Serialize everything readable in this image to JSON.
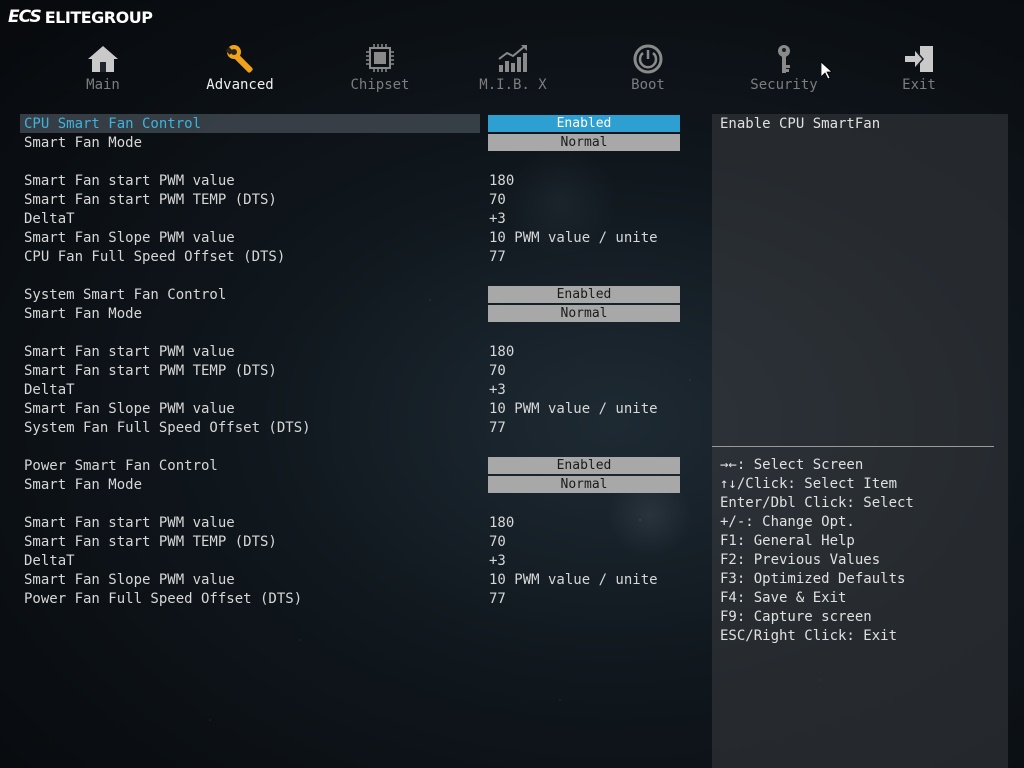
{
  "brand": {
    "logo": "ECS",
    "name": "ELITEGROUP"
  },
  "tabs": [
    {
      "label": "Main",
      "icon": "house-icon",
      "active": false
    },
    {
      "label": "Advanced",
      "icon": "wrench-icon",
      "active": true
    },
    {
      "label": "Chipset",
      "icon": "chip-icon",
      "active": false
    },
    {
      "label": "M.I.B. X",
      "icon": "chart-icon",
      "active": false
    },
    {
      "label": "Boot",
      "icon": "power-icon",
      "active": false
    },
    {
      "label": "Security",
      "icon": "key-icon",
      "active": false
    },
    {
      "label": "Exit",
      "icon": "exit-icon",
      "active": false
    }
  ],
  "settings": {
    "cpu_fan_control": {
      "label": "CPU Smart Fan Control",
      "value": "Enabled"
    },
    "cpu_fan_mode": {
      "label": "Smart Fan Mode",
      "value": "Normal"
    },
    "cpu_start_pwm": {
      "label": "Smart Fan start PWM value",
      "value": "180"
    },
    "cpu_start_temp": {
      "label": "Smart Fan start PWM TEMP (DTS)",
      "value": "70"
    },
    "cpu_delta": {
      "label": "DeltaT",
      "value": "+3"
    },
    "cpu_slope": {
      "label": "Smart Fan Slope PWM value",
      "value": "10 PWM value / unite"
    },
    "cpu_offset": {
      "label": "CPU Fan Full Speed Offset (DTS)",
      "value": "77"
    },
    "sys_fan_control": {
      "label": "System Smart Fan Control",
      "value": "Enabled"
    },
    "sys_fan_mode": {
      "label": "Smart Fan Mode",
      "value": "Normal"
    },
    "sys_start_pwm": {
      "label": "Smart Fan start PWM value",
      "value": "180"
    },
    "sys_start_temp": {
      "label": "Smart Fan start PWM TEMP (DTS)",
      "value": "70"
    },
    "sys_delta": {
      "label": "DeltaT",
      "value": "+3"
    },
    "sys_slope": {
      "label": "Smart Fan Slope PWM value",
      "value": "10 PWM value / unite"
    },
    "sys_offset": {
      "label": "System Fan Full Speed Offset (DTS)",
      "value": "77"
    },
    "pwr_fan_control": {
      "label": "Power Smart Fan Control",
      "value": "Enabled"
    },
    "pwr_fan_mode": {
      "label": "Smart Fan Mode",
      "value": "Normal"
    },
    "pwr_start_pwm": {
      "label": "Smart Fan start PWM value",
      "value": "180"
    },
    "pwr_start_temp": {
      "label": "Smart Fan start PWM TEMP (DTS)",
      "value": "70"
    },
    "pwr_delta": {
      "label": "DeltaT",
      "value": "+3"
    },
    "pwr_slope": {
      "label": "Smart Fan Slope PWM value",
      "value": "10 PWM value / unite"
    },
    "pwr_offset": {
      "label": "Power Fan Full Speed Offset (DTS)",
      "value": "77"
    }
  },
  "help": {
    "description": "Enable CPU SmartFan",
    "keys": [
      "→←: Select Screen",
      "↑↓/Click: Select Item",
      "Enter/Dbl Click: Select",
      "+/-: Change Opt.",
      "F1: General Help",
      "F2: Previous Values",
      "F3: Optimized Defaults",
      "F4: Save & Exit",
      "F9: Capture screen",
      "ESC/Right Click: Exit"
    ]
  },
  "colors": {
    "selected_item": "#3fb3e0",
    "active_option": "#2e9fd1",
    "option_bg": "#a8a8a8"
  }
}
